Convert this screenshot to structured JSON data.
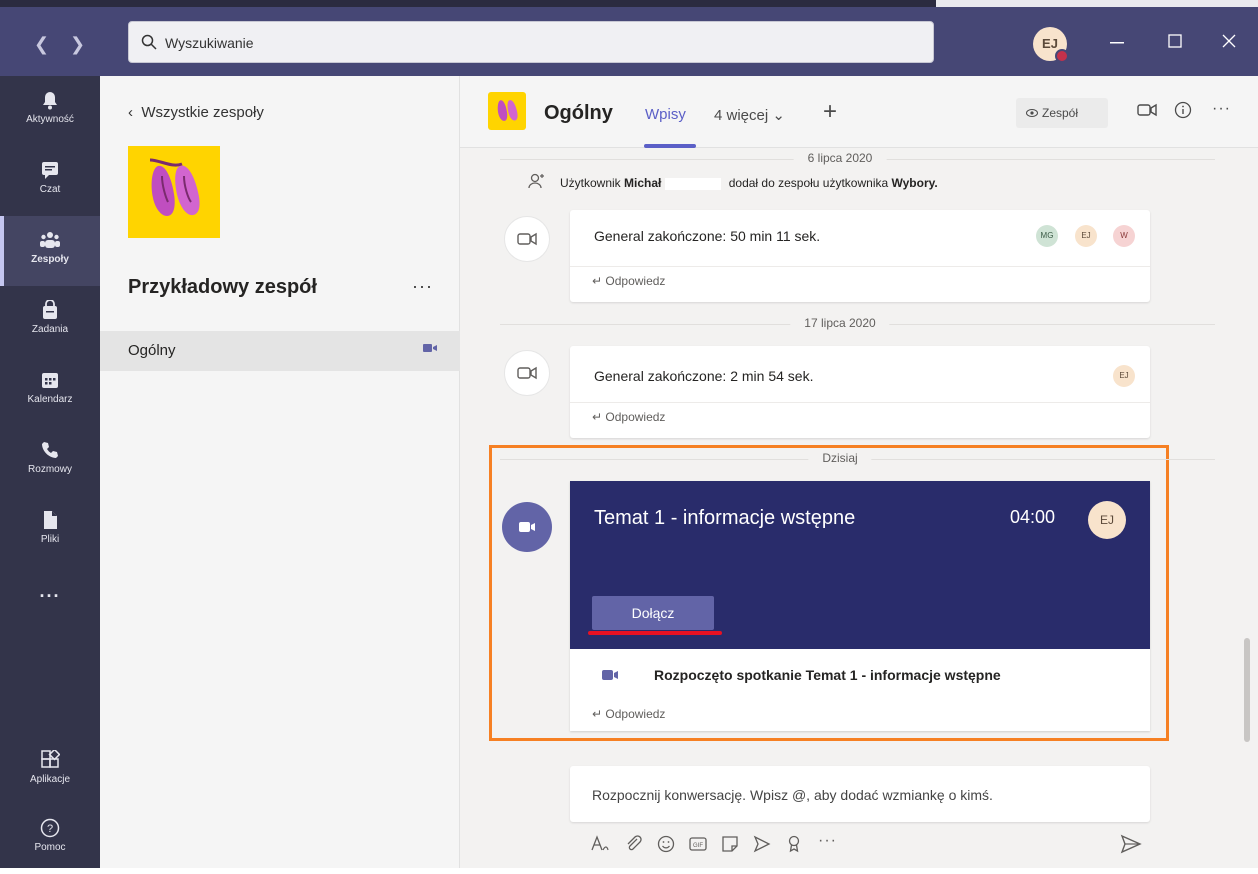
{
  "search": {
    "placeholder": "Wyszukiwanie"
  },
  "user": {
    "initials": "EJ"
  },
  "rail": [
    {
      "label": "Aktywność"
    },
    {
      "label": "Czat"
    },
    {
      "label": "Zespoły"
    },
    {
      "label": "Zadania"
    },
    {
      "label": "Kalendarz"
    },
    {
      "label": "Rozmowy"
    },
    {
      "label": "Pliki"
    },
    {
      "label": "Aplikacje"
    },
    {
      "label": "Pomoc"
    }
  ],
  "rail_more": "...",
  "team_panel": {
    "back_label": "Wszystkie zespoły",
    "team_name": "Przykładowy zespół",
    "more": "···",
    "channel": "Ogólny"
  },
  "header": {
    "channel_name": "Ogólny",
    "tab_posts": "Wpisy",
    "tab_more": "4 więcej ⌄",
    "tab_add": "+",
    "team_button": "Zespół",
    "more": "···"
  },
  "feed": {
    "date_top": "6 lipca 2020",
    "system_msg": {
      "prefix": "Użytkownik",
      "user": "Michał",
      "middle": "dodał do zespołu użytkownika",
      "target": "Wybory."
    },
    "call1": {
      "title": "General zakończone: 50 min 11 sek.",
      "reply": "Odpowiedz",
      "avatars": [
        "MG",
        "EJ",
        "W"
      ]
    },
    "date_mid": "17 lipca 2020",
    "call2": {
      "title": "General zakończone: 2 min 54 sek.",
      "reply": "Odpowiedz",
      "avatars": [
        "EJ"
      ]
    },
    "date_today": "Dzisiaj",
    "meeting": {
      "title": "Temat 1 - informacje wstępne",
      "time": "04:00",
      "avatar": "EJ",
      "join": "Dołącz",
      "started": "Rozpoczęto spotkanie Temat 1 - informacje wstępne",
      "reply": "Odpowiedz"
    }
  },
  "compose": {
    "placeholder": "Rozpocznij konwersację. Wpisz @, aby dodać wzmiankę o kimś."
  },
  "colors": {
    "accent": "#6264a7",
    "titlebar": "#464775",
    "rail": "#33344a",
    "meeting_banner": "#292c6b",
    "highlight": "#f68023",
    "underline": "#e81123"
  }
}
